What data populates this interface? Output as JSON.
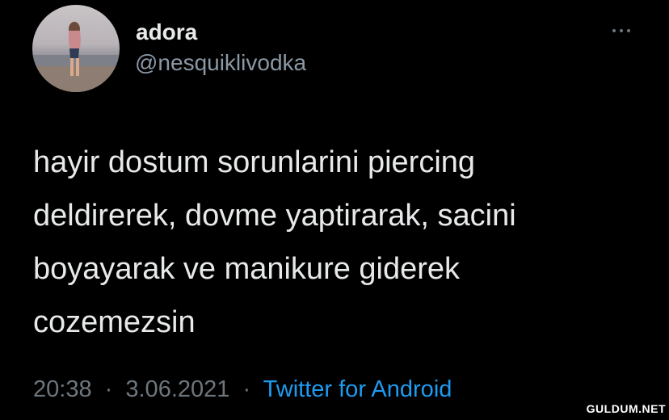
{
  "user": {
    "display_name": "adora",
    "handle": "@nesquiklivodka"
  },
  "tweet": {
    "lines": [
      "hayir dostum sorunlarini piercing",
      "deldirerek, dovme yaptirarak, sacini",
      "boyayarak ve manikure giderek",
      "cozemezsin"
    ]
  },
  "meta": {
    "time": "20:38",
    "date": "3.06.2021",
    "separator": "·",
    "source": "Twitter for Android"
  },
  "watermark": "GULDUM.NET",
  "colors": {
    "background": "#000000",
    "primary_text": "#e7e9ea",
    "secondary_text": "#6e767d",
    "link": "#1d9bf0"
  },
  "icons": {
    "more": "more-horizontal-icon"
  }
}
